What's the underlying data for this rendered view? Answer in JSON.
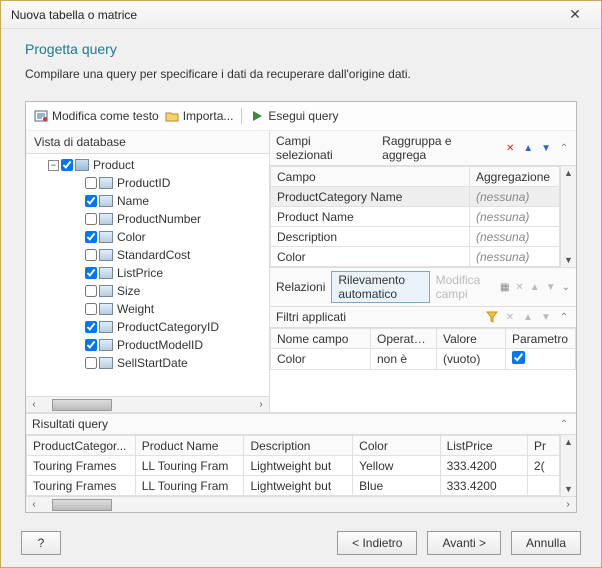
{
  "window": {
    "title": "Nuova tabella o matrice"
  },
  "header": {
    "heading": "Progetta query",
    "subtext": "Compilare una query per specificare i dati da recuperare dall'origine dati."
  },
  "toolbar": {
    "edit_as_text": "Modifica come testo",
    "import": "Importa...",
    "run_query": "Esegui query"
  },
  "tree": {
    "title": "Vista di database",
    "root": "Product",
    "items": [
      {
        "label": "ProductID",
        "checked": false
      },
      {
        "label": "Name",
        "checked": true
      },
      {
        "label": "ProductNumber",
        "checked": false
      },
      {
        "label": "Color",
        "checked": true
      },
      {
        "label": "StandardCost",
        "checked": false
      },
      {
        "label": "ListPrice",
        "checked": true
      },
      {
        "label": "Size",
        "checked": false
      },
      {
        "label": "Weight",
        "checked": false
      },
      {
        "label": "ProductCategoryID",
        "checked": true
      },
      {
        "label": "ProductModelID",
        "checked": true
      },
      {
        "label": "SellStartDate",
        "checked": false
      }
    ]
  },
  "selected_fields": {
    "title": "Campi selezionati",
    "group_label": "Raggruppa e aggrega",
    "col_field": "Campo",
    "col_agg": "Aggregazione",
    "rows": [
      {
        "field": "ProductCategory Name",
        "agg": "(nessuna)",
        "selected": true
      },
      {
        "field": "Product Name",
        "agg": "(nessuna)",
        "selected": false
      },
      {
        "field": "Description",
        "agg": "(nessuna)",
        "selected": false
      },
      {
        "field": "Color",
        "agg": "(nessuna)",
        "selected": false
      }
    ]
  },
  "relations": {
    "title": "Relazioni",
    "auto_detect": "Rilevamento automatico",
    "edit_fields": "Modifica campi"
  },
  "filters": {
    "title": "Filtri applicati",
    "col_name": "Nome campo",
    "col_op": "Operatore",
    "col_val": "Valore",
    "col_param": "Parametro",
    "rows": [
      {
        "name": "Color",
        "op": "non è",
        "val": "(vuoto)",
        "param": true
      }
    ]
  },
  "results": {
    "title": "Risultati query",
    "columns": [
      "ProductCategor...",
      "Product Name",
      "Description",
      "Color",
      "ListPrice",
      "Pr"
    ],
    "rows": [
      [
        "Touring Frames",
        "LL Touring Fram",
        "Lightweight but",
        "Yellow",
        "333.4200",
        "2("
      ],
      [
        "Touring Frames",
        "LL Touring Fram",
        "Lightweight but",
        "Blue",
        "333.4200",
        ""
      ]
    ]
  },
  "footer": {
    "help": "?",
    "back": "<  Indietro",
    "next": "Avanti  >",
    "cancel": "Annulla"
  }
}
